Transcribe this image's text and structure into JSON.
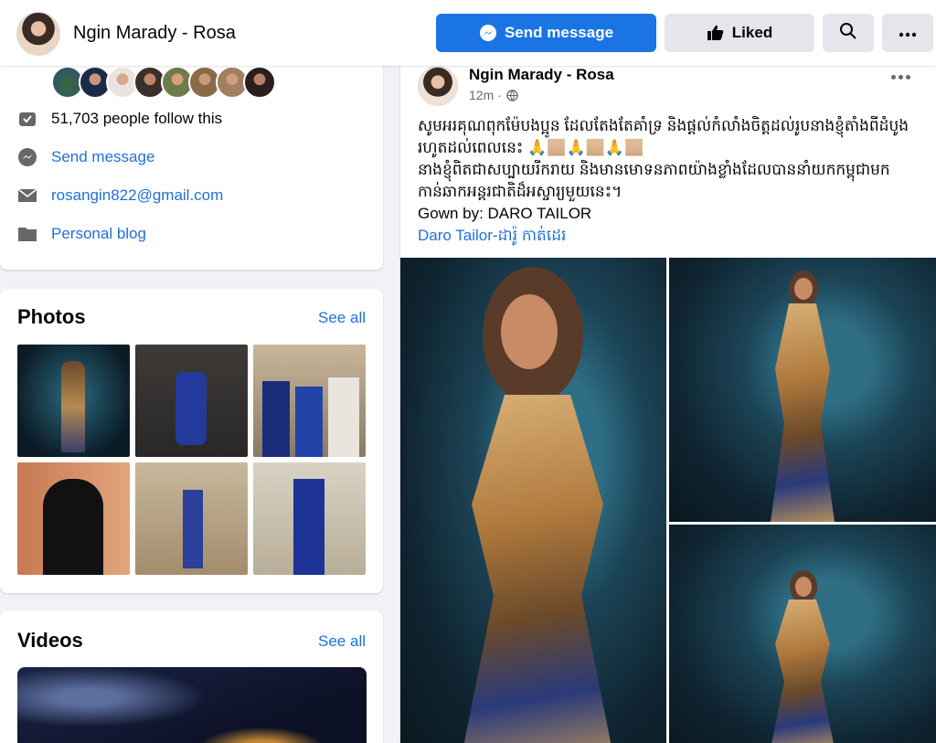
{
  "header": {
    "page_name": "Ngin Marady - Rosa",
    "send_message_label": "Send message",
    "liked_label": "Liked",
    "accent_color": "#1b74e4"
  },
  "intro": {
    "followers_text": "51,703 people follow this",
    "send_message_text": "Send message",
    "email": "rosangin822@gmail.com",
    "blog_text": "Personal blog"
  },
  "photos": {
    "title": "Photos",
    "see_all": "See all"
  },
  "videos": {
    "title": "Videos",
    "see_all": "See all"
  },
  "post": {
    "author": "Ngin Marady - Rosa",
    "time": "12m ·",
    "line1": "សូមអរគុណពុកម៉ែបងប្អូន ដែលតែងតែគាំទ្រ និងផ្តល់កំលាំងចិត្តដល់រូបនាងខ្ញុំតាំងពីដំបូងរហូតដល់ពេលនេះ 🙏🏼🙏🏼🙏🏼",
    "line2": "នាងខ្ញុំពិតជាសប្បាយរីករាយ និងមានមោទនភាពយ៉ាងខ្លាំងដែលបាននាំយកកម្ពុជាមកកាន់ឆាកអន្តរជាតិដ៏អស្ចារ្យមួយនេះ។",
    "gown_line": "Gown by: DARO TAILOR",
    "link_text": "Daro Tailor-ដារ៉ូ កាត់ដេរ"
  }
}
